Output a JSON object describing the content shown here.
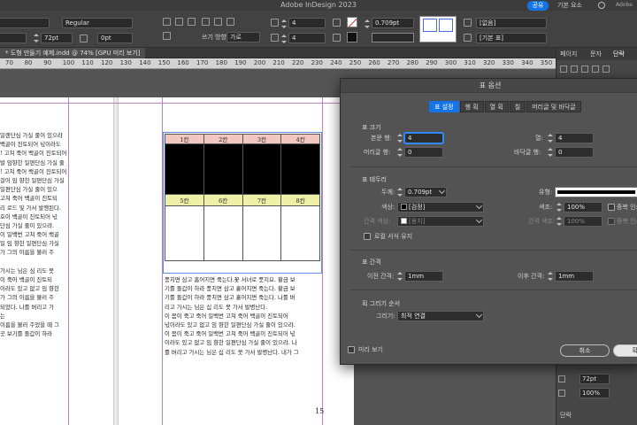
{
  "app": {
    "title": "Adobe InDesign 2023",
    "share_label": "공유",
    "workspace_label": "기본 요소",
    "adobe_label": "Adobe"
  },
  "controlbar": {
    "font_style": "Regular",
    "font_size": "72pt",
    "tracking": "0pt",
    "writing_direction_label": "쓰기 방향",
    "writing_direction": "가로",
    "rows": "4",
    "cols": "4",
    "stroke_weight": "0.709pt",
    "cell_style": "[없음]",
    "table_style": "[기본 표]"
  },
  "document_tab": "*  도형 만들기 예제.indd @ 74% [GPU 미리 보기]",
  "ruler_labels": [
    "70",
    "80",
    "90",
    "100",
    "110",
    "120",
    "130",
    "140",
    "150",
    "160",
    "170",
    "180",
    "190",
    "200",
    "210",
    "220",
    "230",
    "240",
    "250",
    "260",
    "270",
    "280",
    "290",
    "300",
    "310",
    "320",
    "330",
    "340",
    "350"
  ],
  "left_page_text": [
    "일렌단심 가실 줄이 있으랴",
    "백골이 진토되어 넋이라도",
    "! 고쳐 죽어 백골이 진토되어",
    "발 임향한 일편단심 가실 줄",
    "! 고쳐 죽어 백골이 진토되어",
    "걸어 임 향한 일편단심 가실",
    "일편단심 가실 줄이 있으",
    "고쳐 죽어 백골이 진토되",
    "리 로드 및 가서 발행된다.",
    "호이 백골이 진토되어 넋",
    "단심 가실 줄이 있으랴.",
    "이 일백번 고쳐 죽어 백골",
    "일 임 향한 일편단심 가실",
    "가 그의 이름을 불러 주",
    "",
    "가시는 님은 심 리도 못",
    "이 죽어 백골이 진토되",
    "이라도 있고 없고 임 향한",
    "가 그의 이름을 불러 주",
    "되었다. 나를 버리고 가",
    "는",
    "이름을 불러 주었을 때 그",
    "곳 보기를 돌갑이 하라"
  ],
  "right_page_text": [
    "풍치면 삼고 홉어지면 죽는다.꽃 서녀로 풋지요. 황금 보",
    "기를 돌갑이 하라 풍치면 삼고 흩어지면 죽는다. 황금 보",
    "기를 돌갑이 하라 풍치면 삼고 흩어지면 죽는다. 나를 버",
    "리고 가시는 님은 십 리도 못 가서 발병난다.",
    "    이 몸이 죽고 죽어 일백번 고쳐 죽어 백골이 진토되어",
    "넋이라도 있고 없고 임 향한 일편단심 가실 줄이 있으랴.",
    "이 몸이 죽고 죽어 일백번 고쳐 죽어 백골이 진토되어 넋",
    "이라도 있고 없고 임 향한 일편단심 가실 줄이 있으랴. 나",
    "를 버리고 가시는 님은 십 리도 못 가서 발병난다. 내가 그"
  ],
  "table": {
    "header_row_1": [
      "1칸",
      "2칸",
      "3칸",
      "4칸"
    ],
    "header_row_2": [
      "5칸",
      "6칸",
      "7칸",
      "8칸"
    ]
  },
  "page_number": "15",
  "right_panel": {
    "tabs": [
      "페이지",
      "문자",
      "단락"
    ],
    "active_tab": "단락",
    "font_size": "72pt",
    "scale": "100%",
    "section_label": "단락"
  },
  "dialog": {
    "title": "표 옵션",
    "tabs": [
      "표 설정",
      "행 획",
      "열 획",
      "칠",
      "머리글 및 바닥글"
    ],
    "active_tab": "표 설정",
    "size_section": "표 크기",
    "body_rows_label": "본문 행:",
    "body_rows": "4",
    "columns_label": "열:",
    "columns": "4",
    "header_rows_label": "머리글 행:",
    "header_rows": "0",
    "footer_rows_label": "바닥글 행:",
    "footer_rows": "0",
    "border_section": "표 테두리",
    "weight_label": "두께:",
    "weight": "0.709pt",
    "type_label": "유형:",
    "color_label": "색상:",
    "color_value": "[검정]",
    "tint_label": "색조:",
    "tint_value": "100%",
    "overprint_label": "중복 인쇄",
    "gap_color_label": "간격 색상:",
    "gap_color_value": "[용지]",
    "gap_tint_label": "간격 색조:",
    "gap_tint_value": "100%",
    "gap_overprint_label": "중복 인쇄",
    "preserve_local_label": "로컬 서식 유지",
    "spacing_section": "표 간격",
    "space_before_label": "이전 간격:",
    "space_before": "1mm",
    "space_after_label": "이후 간격:",
    "space_after": "1mm",
    "stroke_order_section": "획 그리기 순서",
    "draw_label": "그리기:",
    "draw_value": "최적 연결",
    "preview_label": "미리 보기",
    "cancel_label": "취소",
    "ok_label": "확인"
  }
}
